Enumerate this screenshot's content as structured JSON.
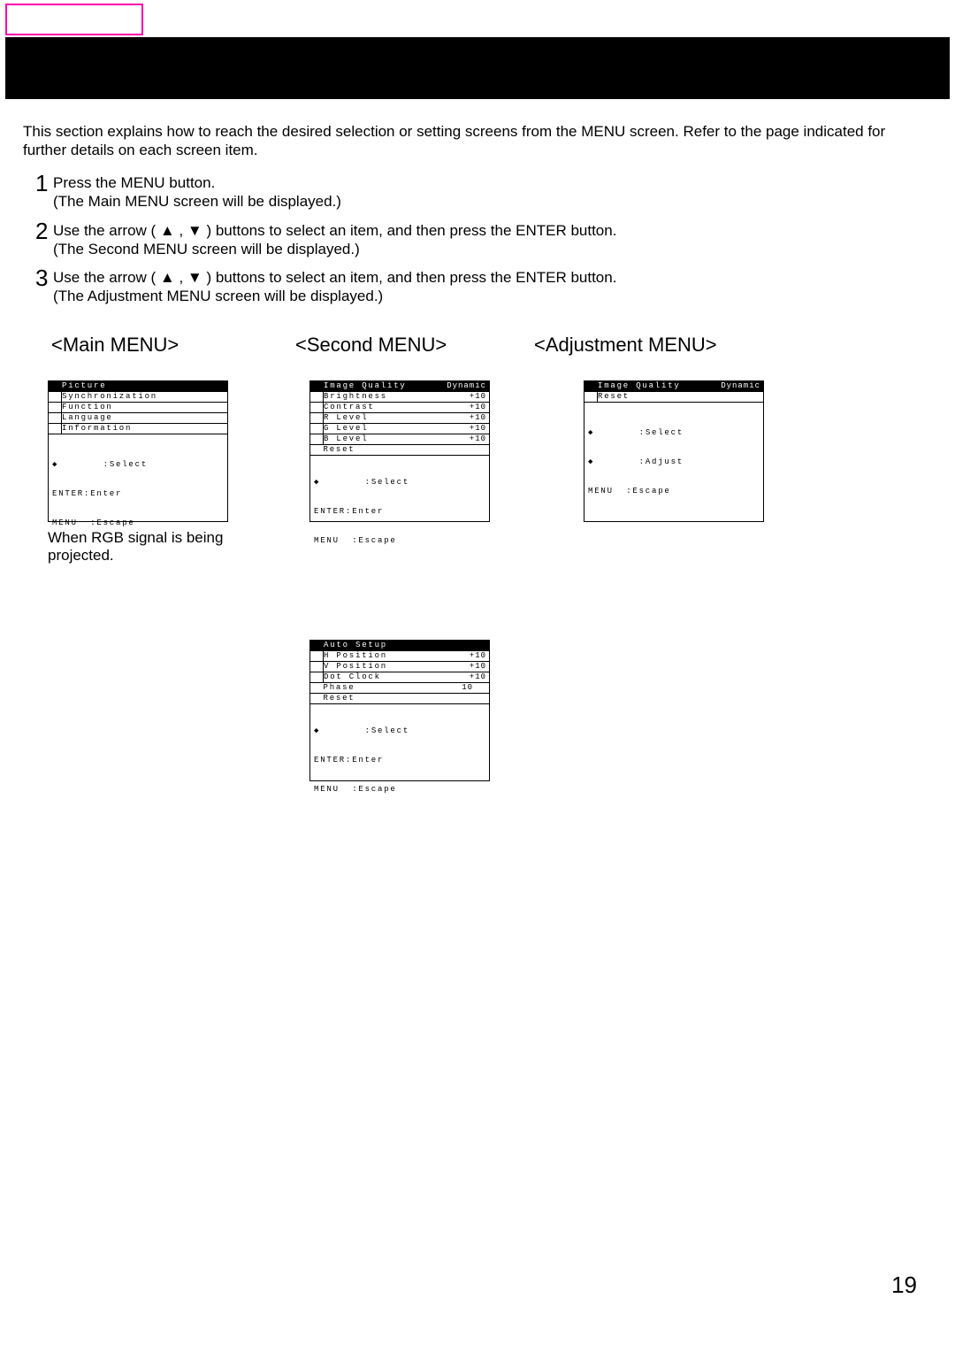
{
  "intro": "This section explains how to reach the desired selection or setting screens from the MENU screen. Refer to the page indicated for further details on each screen item.",
  "steps": {
    "s1a": "Press the MENU button.",
    "s1b": "(The Main MENU screen will be displayed.)",
    "s2a": "Use the arrow (  ▲ , ▼ ) buttons  to select an item, and then press the ENTER button.",
    "s2b": "(The Second MENU screen will be displayed.)",
    "s3a": "Use the arrow (  ▲ , ▼ ) buttons  to select an item, and then press the ENTER button.",
    "s3b": "(The Adjustment MENU screen will be displayed.)"
  },
  "headings": {
    "main": "<Main MENU>",
    "second": "<Second MENU>",
    "adjust": "<Adjustment MENU>"
  },
  "main_menu": {
    "rows": [
      "Picture",
      "Synchronization",
      "Function",
      "Language",
      "Information"
    ],
    "hints": {
      "select": "◆       :Select",
      "enter": "ENTER:Enter",
      "escape": "MENU  :Escape"
    }
  },
  "caption_main": "When RGB signal is being projected.",
  "second_top": {
    "header_l": "Image Quality",
    "header_r": "Dynamic",
    "rows": [
      {
        "l": "Brightness",
        "v": "+10"
      },
      {
        "l": "Contrast",
        "v": "+10"
      },
      {
        "l": "R Level",
        "v": "+10"
      },
      {
        "l": "G Level",
        "v": "+10"
      },
      {
        "l": "B Level",
        "v": "+10"
      },
      {
        "l": "Reset",
        "v": ""
      }
    ],
    "hints": {
      "select": "◆       :Select",
      "enter": "ENTER:Enter",
      "escape": "MENU  :Escape"
    }
  },
  "second_bot": {
    "header_l": "Auto Setup",
    "rows": [
      {
        "l": "H Position",
        "v": "+10"
      },
      {
        "l": "V Position",
        "v": "+10"
      },
      {
        "l": "Dot Clock",
        "v": "+10"
      },
      {
        "l": "Phase",
        "v": "10"
      },
      {
        "l": "Reset",
        "v": ""
      }
    ],
    "hints": {
      "select": "◆       :Select",
      "enter": "ENTER:Enter",
      "escape": "MENU  :Escape"
    }
  },
  "adjust": {
    "header_l": "Image Quality",
    "header_r": "Dynamic",
    "rows": [
      {
        "l": "Reset",
        "v": ""
      }
    ],
    "hints": {
      "select": "◆       :Select",
      "adjust": "◆       :Adjust",
      "escape": "MENU  :Escape"
    }
  },
  "page": "19"
}
